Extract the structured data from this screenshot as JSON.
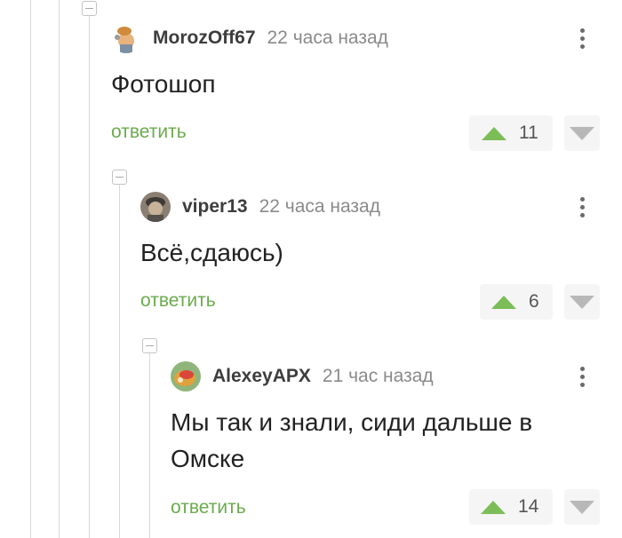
{
  "colors": {
    "reply": "#6bab4d",
    "upvote": "#7cbd57",
    "downvote": "#b8b8b8",
    "thread_line": "#d8d8d8"
  },
  "comments": [
    {
      "author": "MorozOff67",
      "time": "22 часа назад",
      "text": "Фотошоп",
      "reply_label": "ответить",
      "rating": "11",
      "menu_icon": "more-vertical-icon"
    },
    {
      "author": "viper13",
      "time": "22 часа назад",
      "text": "Всё,сдаюсь)",
      "reply_label": "ответить",
      "rating": "6",
      "menu_icon": "more-vertical-icon"
    },
    {
      "author": "AlexeyAPX",
      "time": "21 час назад",
      "text": "Мы так и знали, сиди дальше в Омске",
      "reply_label": "ответить",
      "rating": "14",
      "menu_icon": "more-vertical-icon"
    }
  ]
}
